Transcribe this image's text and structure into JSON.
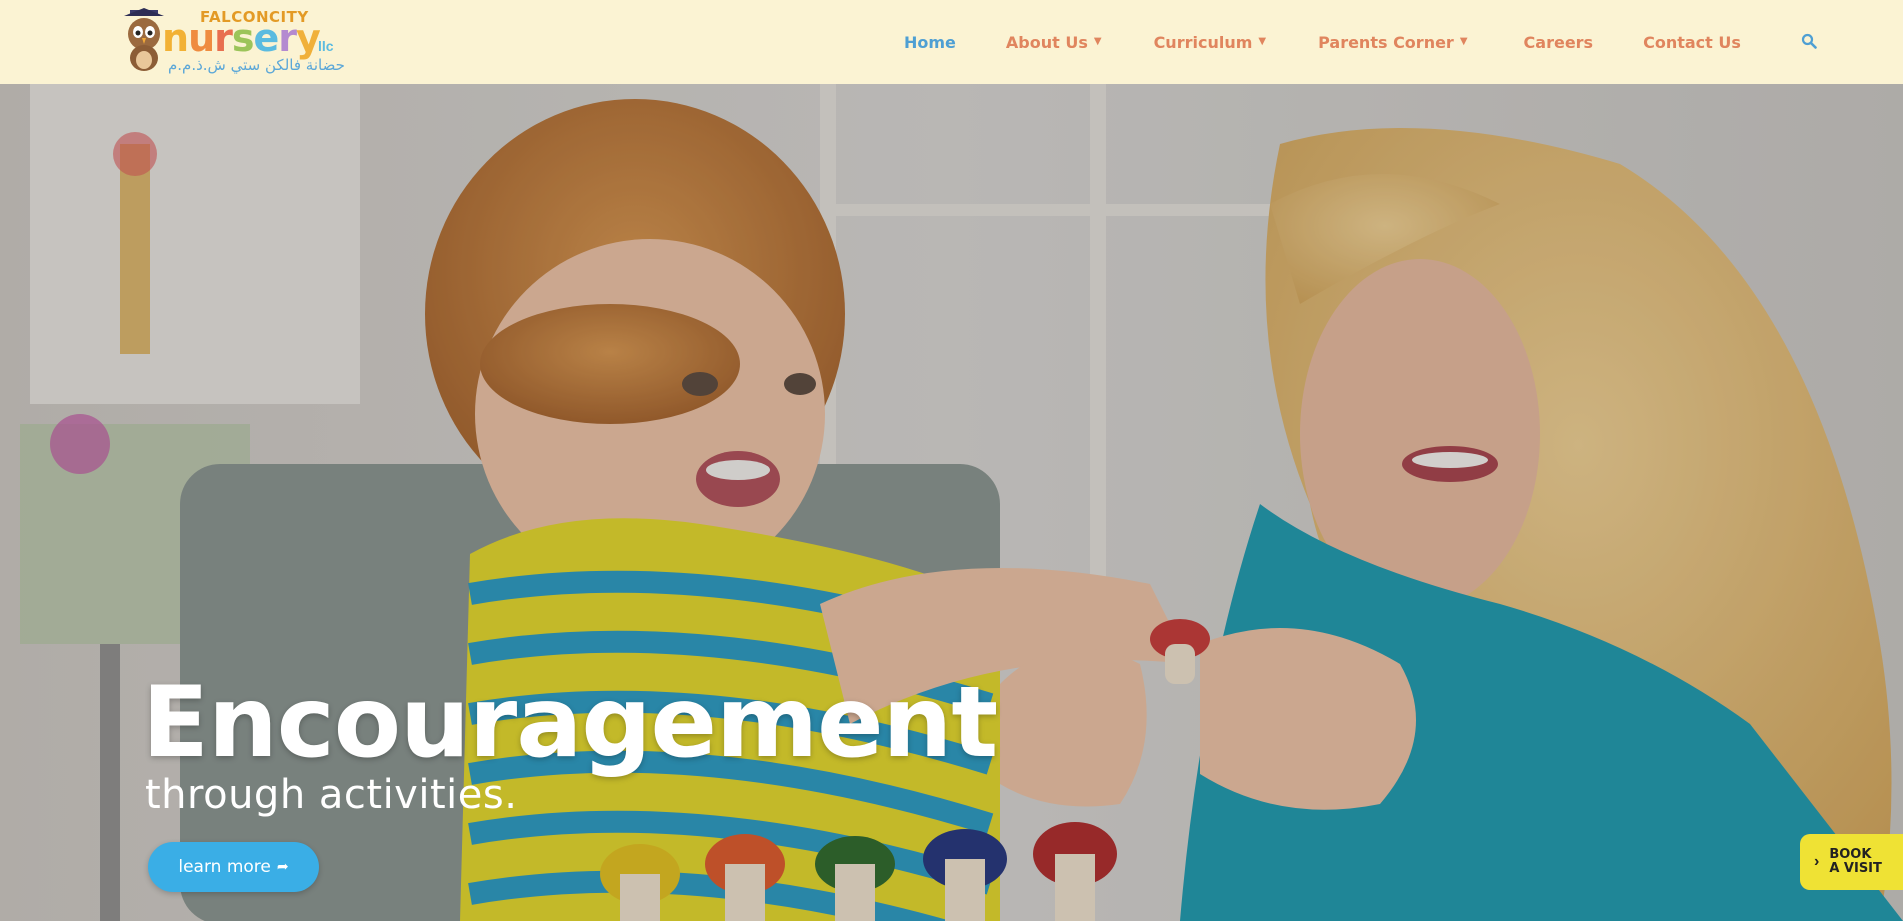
{
  "logo": {
    "top_text": "FALCONCITY",
    "main_letters": [
      "n",
      "u",
      "r",
      "s",
      "e",
      "r",
      "y"
    ],
    "suffix": "llc",
    "arabic_text": "حضانة فالكن ستي ش.ذ.م.م",
    "alt": "Falconcity Nursery logo"
  },
  "nav": {
    "items": [
      {
        "label": "Home",
        "active": true
      },
      {
        "label": "About Us",
        "dropdown": true
      },
      {
        "label": "Curriculum",
        "dropdown": true
      },
      {
        "label": "Parents Corner",
        "dropdown": true
      },
      {
        "label": "Careers"
      },
      {
        "label": "Contact Us"
      }
    ],
    "search_icon": "search-icon"
  },
  "hero": {
    "title": "Encouragement",
    "subtitle": "through activities.",
    "button_label": "learn more",
    "button_icon": "share-arrow-icon"
  },
  "book_visit": {
    "line1": "BOOK",
    "line2": "A VISIT",
    "icon": "chevron-right-icon"
  },
  "colors": {
    "header_bg": "#fbf3d3",
    "nav_text": "#e0855e",
    "nav_active": "#4e9fd3",
    "button_blue": "#3aaee6",
    "book_visit_yellow": "#efe234"
  }
}
